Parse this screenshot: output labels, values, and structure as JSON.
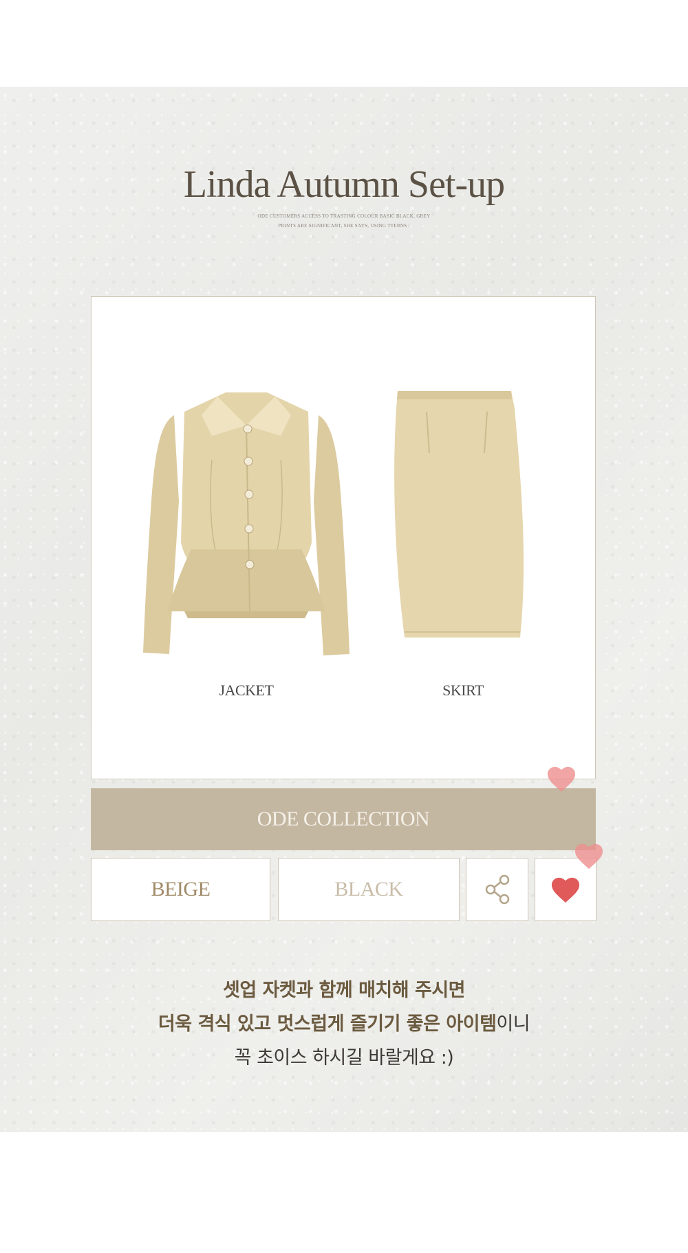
{
  "header": {
    "title": "Linda Autumn Set-up",
    "subtitle_line1": "ODE CUSTOMERS ACCESS TO TRASTING COLOUR BASIC BLACK, GREY",
    "subtitle_line2": "PRINTS ARE SIGNIFICANT, SHE SAYS, USING TTERNS /"
  },
  "products": {
    "jacket_label": "JACKET",
    "skirt_label": "SKIRT"
  },
  "banner": {
    "label": "ODE COLLECTION"
  },
  "options": {
    "beige_label": "BEIGE",
    "black_label": "BLACK"
  },
  "icons": {
    "share": "share-icon",
    "like": "heart-icon",
    "float_heart": "heart-icon"
  },
  "description": {
    "line1": "셋업 자켓과 함께 매치해 주시면",
    "line2_bold": "더욱 격식 있고 멋스럽게 즐기기 좋은 아이템",
    "line2_rest": "이니",
    "line3": "꼭 초이스 하시길 바랄게요 :)"
  },
  "colors": {
    "beige_fabric": "#e6d6ad",
    "banner_bg": "#c4b7a1",
    "beige_text": "#a08a67",
    "black_text": "#c9bda9",
    "heart": "#e05a5a",
    "heart_faded": "#ee8f8f"
  }
}
